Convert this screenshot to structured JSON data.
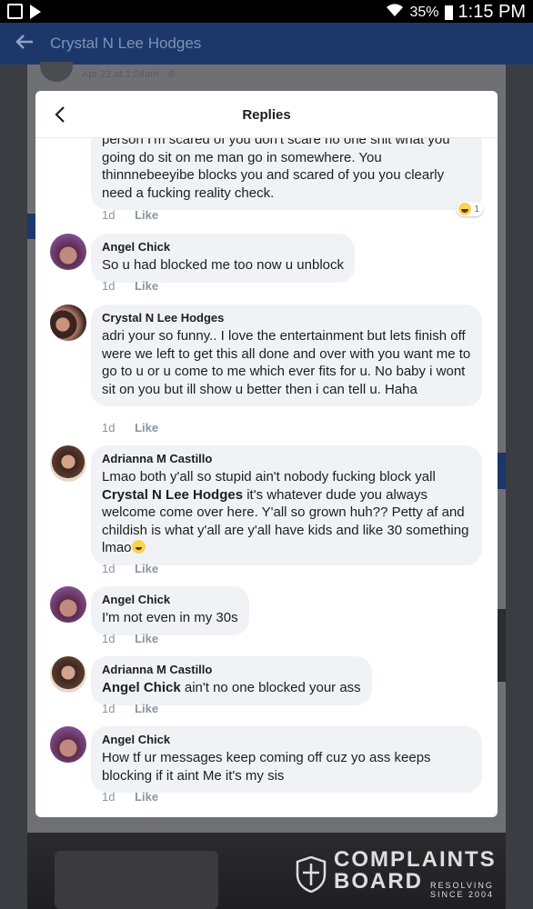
{
  "status_bar": {
    "battery": "35%",
    "time": "1:15 PM"
  },
  "app_bar": {
    "title": "Crystal N Lee Hodges"
  },
  "background": {
    "post_meta": "Apr 21 at 1:04am · ⊕"
  },
  "modal": {
    "title": "Replies",
    "reaction_count": "1",
    "comments": [
      {
        "author": "",
        "text": "person I'm scared of you don't scare no one shit what you going do sit on me man go in somewhere. You thinnnebeeyibe blocks you and scared of you you clearly need a fucking reality check.",
        "time": "1d",
        "like": "Like"
      },
      {
        "author": "Angel Chick",
        "text": "So u had blocked me too now u unblock",
        "time": "1d",
        "like": "Like"
      },
      {
        "author": "Crystal N Lee Hodges",
        "text": "adri your so funny.. I love the entertainment but lets finish off were we left to get this all done and over with you want me to go to u or u come to me which ever fits for u. No baby i wont sit on you but ill show u better then i can tell u. Haha",
        "time": "1d",
        "like": "Like"
      },
      {
        "author": "Adrianna M Castillo",
        "text_before": "Lmao both y'all so stupid ain't nobody fucking block yall ",
        "mention": "Crystal N Lee Hodges",
        "text_after": " it's whatever dude you always welcome come over here. Y'all so grown huh?? Petty af and childish is what y'all are y'all have kids and like 30 something lmao",
        "time": "1d",
        "like": "Like"
      },
      {
        "author": "Angel Chick",
        "text": "I'm not even in my 30s",
        "time": "1d",
        "like": "Like"
      },
      {
        "author": "Adrianna M Castillo",
        "mention": "Angel Chick",
        "text_after": " ain't no one blocked your ass",
        "time": "1d",
        "like": "Like"
      },
      {
        "author": "Angel Chick",
        "text": "How tf  ur messages keep  coming off cuz yo  ass keeps blocking if it aint  Me it's my sis",
        "time": "1d",
        "like": "Like"
      }
    ]
  },
  "watermark": {
    "line1": "COMPLAINTS",
    "line2": "BOARD",
    "small1": "RESOLVING",
    "small2": "SINCE 2004"
  },
  "colors": {
    "app_bar": "#1c3769",
    "bubble": "#f0f2f5",
    "meta_text": "#8d949e"
  }
}
